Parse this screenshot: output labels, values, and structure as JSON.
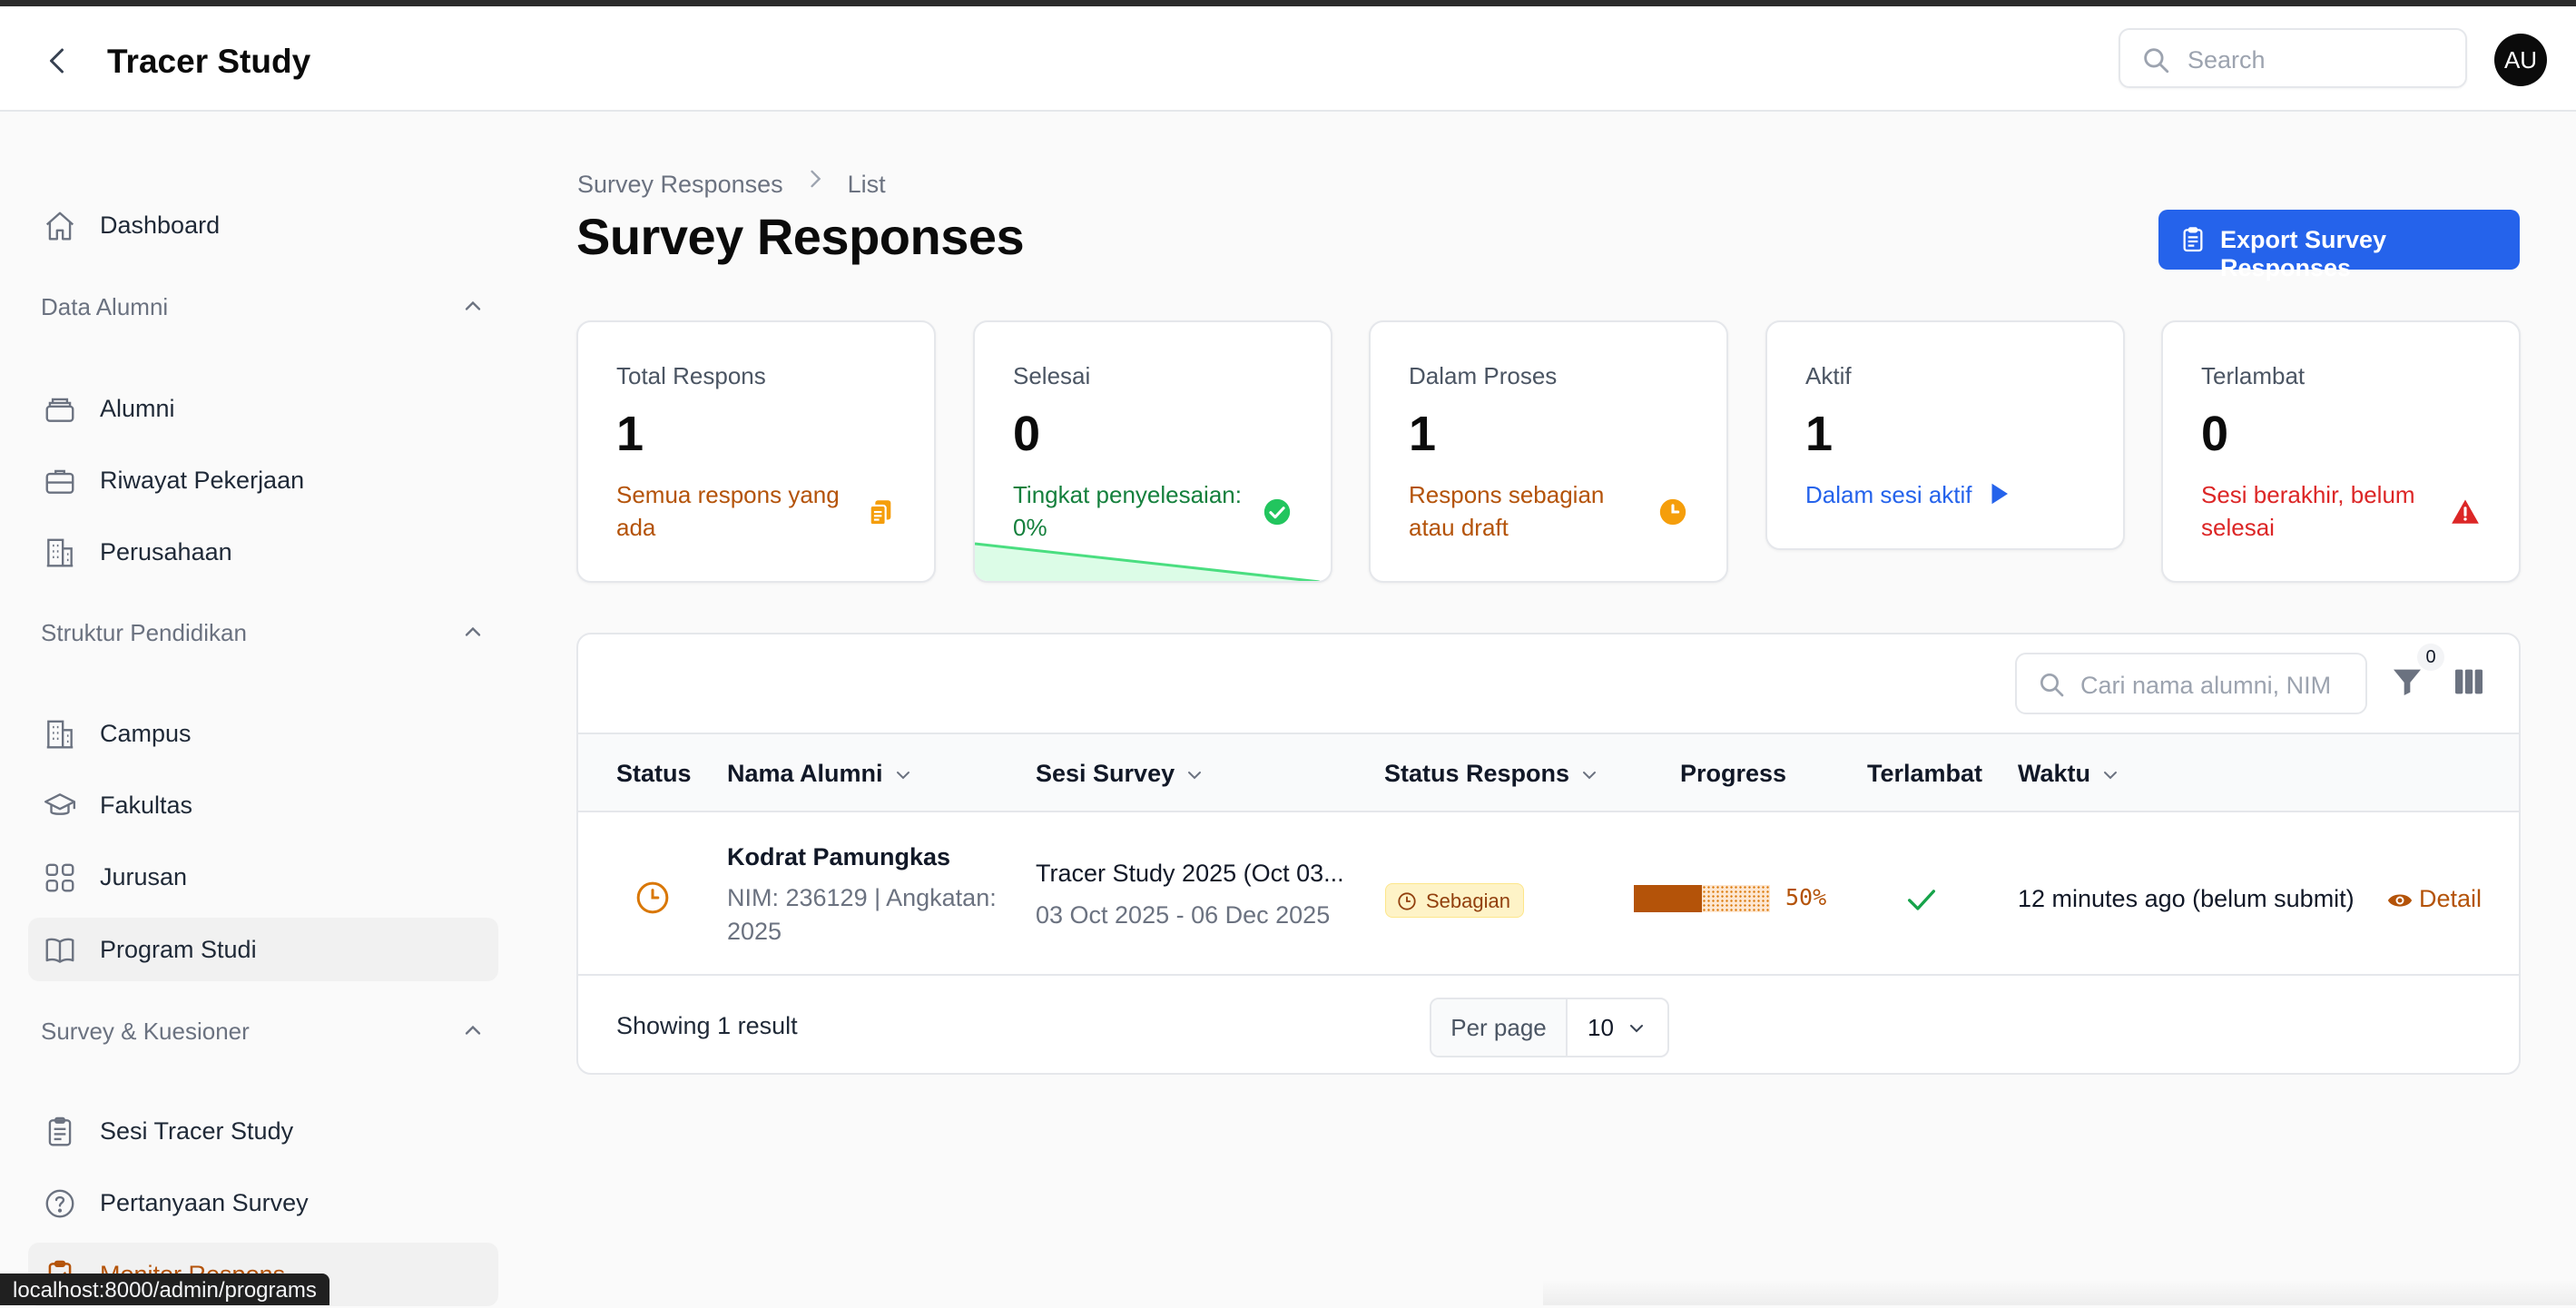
{
  "app": {
    "title": "Tracer Study",
    "avatar_initials": "AU"
  },
  "search": {
    "placeholder": "Search"
  },
  "sidebar": {
    "dashboard": "Dashboard",
    "groups": [
      {
        "label": "Data Alumni",
        "items": [
          "Alumni",
          "Riwayat Pekerjaan",
          "Perusahaan"
        ]
      },
      {
        "label": "Struktur Pendidikan",
        "items": [
          "Campus",
          "Fakultas",
          "Jurusan",
          "Program Studi"
        ]
      },
      {
        "label": "Survey & Kuesioner",
        "items": [
          "Sesi Tracer Study",
          "Pertanyaan Survey",
          "Monitor Respons"
        ]
      }
    ]
  },
  "breadcrumb": {
    "parent": "Survey Responses",
    "current": "List"
  },
  "page": {
    "title": "Survey Responses",
    "export_label": "Export Survey Responses"
  },
  "stats": [
    {
      "label": "Total Respons",
      "value": "1",
      "desc": "Semua respons yang ada",
      "color": "#b45309",
      "icon": "documents-icon"
    },
    {
      "label": "Selesai",
      "value": "0",
      "desc": "Tingkat penyelesaian: 0%",
      "color": "#15803d",
      "icon": "check-circle-icon"
    },
    {
      "label": "Dalam Proses",
      "value": "1",
      "desc": "Respons sebagian atau draft",
      "color": "#b45309",
      "icon": "clock-icon"
    },
    {
      "label": "Aktif",
      "value": "1",
      "desc": "Dalam sesi aktif",
      "color": "#2563eb",
      "icon": "play-icon"
    },
    {
      "label": "Terlambat",
      "value": "0",
      "desc": "Sesi berakhir, belum selesai",
      "color": "#dc2626",
      "icon": "warning-icon"
    }
  ],
  "table": {
    "search_placeholder": "Cari nama alumni, NIM",
    "filter_count": "0",
    "columns": [
      "Status",
      "Nama Alumni",
      "Sesi Survey",
      "Status Respons",
      "Progress",
      "Terlambat",
      "Waktu"
    ],
    "rows": [
      {
        "name": "Kodrat Pamungkas",
        "meta": "NIM: 236129 | Angkatan: 2025",
        "session": "Tracer Study 2025 (Oct 03...",
        "session_dates": "03 Oct 2025 - 06 Dec 2025",
        "status": "Sebagian",
        "progress": 50,
        "progress_label": "50%",
        "waktu": "12 minutes ago (belum submit)",
        "action": "Detail"
      }
    ],
    "footer": {
      "summary": "Showing 1 result",
      "per_page_label": "Per page",
      "per_page_value": "10"
    }
  },
  "status_url": "localhost:8000/admin/programs"
}
